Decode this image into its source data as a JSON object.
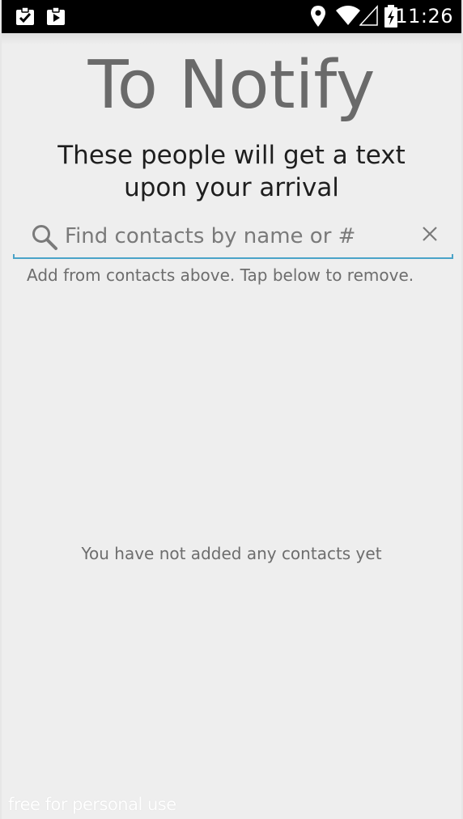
{
  "status_bar": {
    "time": "11:26",
    "icons": [
      "clipboard-check-icon",
      "clipboard-play-icon",
      "location-pin-icon",
      "wifi-icon",
      "signal-icon",
      "battery-charging-icon"
    ]
  },
  "page": {
    "title": "To Notify",
    "subtitle_line1": "These people will get a text",
    "subtitle_line2": "upon your arrival"
  },
  "search": {
    "placeholder": "Find contacts by name or #",
    "value": ""
  },
  "hint": "Add from contacts above. Tap below to remove.",
  "empty_state": "You have not added any contacts yet",
  "watermark": "free for personal use",
  "colors": {
    "accent": "#4aa3c8",
    "background": "#eeeeee",
    "status_bar": "#000000",
    "title": "#6a6a6a"
  }
}
